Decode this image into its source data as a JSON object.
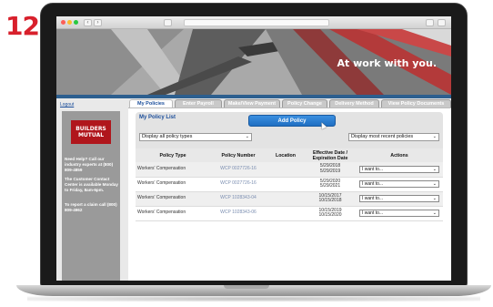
{
  "step_number": "12",
  "hero": {
    "tagline": "At work with you."
  },
  "links": {
    "logout": "Logout"
  },
  "sidebar": {
    "logo_line1": "BUILDERS",
    "logo_line2": "MUTUAL",
    "help_text": "Need Help? Call our industry experts at (800) 809-4859",
    "support_text": "The Customer Contact Center is available Monday to Friday, 8am-6pm.",
    "claim_text": "To report a claim call (800) 809-4962"
  },
  "tabs": [
    {
      "label": "My Policies"
    },
    {
      "label": "Enter Payroll"
    },
    {
      "label": "Make/View Payment"
    },
    {
      "label": "Policy Change"
    },
    {
      "label": "Delivery Method"
    },
    {
      "label": "View Policy Documents"
    }
  ],
  "panel": {
    "title": "My Policy List",
    "add_button": "Add Policy",
    "filter_select": "Display all policy types",
    "sort_select": "Display most recent policies"
  },
  "table": {
    "headers": {
      "type": "Policy Type",
      "number": "Policy Number",
      "location": "Location",
      "dates": "Effective Date / Expiration Date",
      "actions": "Actions"
    },
    "rows": [
      {
        "type": "Workers' Compensation",
        "number": "WCP 0027726-16",
        "location": "",
        "effective": "5/29/2018",
        "expiration": "5/29/2019",
        "action": "I want to..."
      },
      {
        "type": "Workers' Compensation",
        "number": "WCP 0027726-16",
        "location": "",
        "effective": "5/29/2020",
        "expiration": "5/29/2021",
        "action": "I want to..."
      },
      {
        "type": "Workers' Compensation",
        "number": "WCP 1028343-04",
        "location": "",
        "effective": "10/15/2017",
        "expiration": "10/15/2018",
        "action": "I want to..."
      },
      {
        "type": "Workers' Compensation",
        "number": "WCP 1028343-06",
        "location": "",
        "effective": "10/15/2019",
        "expiration": "10/15/2020",
        "action": "I want to..."
      }
    ]
  },
  "colors": {
    "brand_red": "#b0161c",
    "accent_blue": "#1f6fc2",
    "step_red": "#d8202c"
  }
}
